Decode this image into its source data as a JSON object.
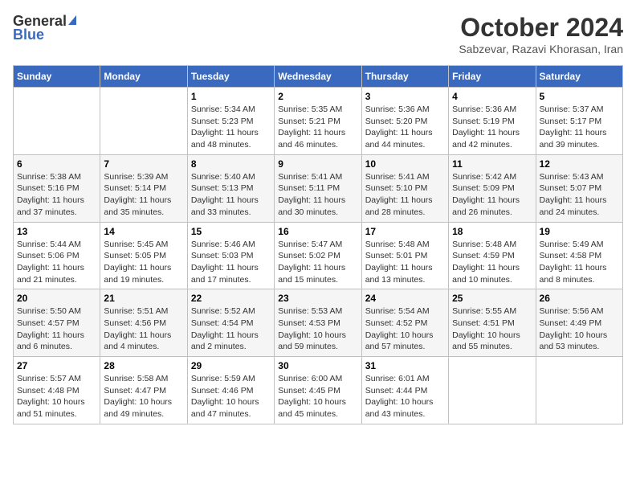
{
  "header": {
    "logo_general": "General",
    "logo_blue": "Blue",
    "month_title": "October 2024",
    "location": "Sabzevar, Razavi Khorasan, Iran"
  },
  "days_of_week": [
    "Sunday",
    "Monday",
    "Tuesday",
    "Wednesday",
    "Thursday",
    "Friday",
    "Saturday"
  ],
  "weeks": [
    {
      "days": [
        {
          "number": "",
          "sunrise": "",
          "sunset": "",
          "daylight": ""
        },
        {
          "number": "",
          "sunrise": "",
          "sunset": "",
          "daylight": ""
        },
        {
          "number": "1",
          "sunrise": "Sunrise: 5:34 AM",
          "sunset": "Sunset: 5:23 PM",
          "daylight": "Daylight: 11 hours and 48 minutes."
        },
        {
          "number": "2",
          "sunrise": "Sunrise: 5:35 AM",
          "sunset": "Sunset: 5:21 PM",
          "daylight": "Daylight: 11 hours and 46 minutes."
        },
        {
          "number": "3",
          "sunrise": "Sunrise: 5:36 AM",
          "sunset": "Sunset: 5:20 PM",
          "daylight": "Daylight: 11 hours and 44 minutes."
        },
        {
          "number": "4",
          "sunrise": "Sunrise: 5:36 AM",
          "sunset": "Sunset: 5:19 PM",
          "daylight": "Daylight: 11 hours and 42 minutes."
        },
        {
          "number": "5",
          "sunrise": "Sunrise: 5:37 AM",
          "sunset": "Sunset: 5:17 PM",
          "daylight": "Daylight: 11 hours and 39 minutes."
        }
      ]
    },
    {
      "days": [
        {
          "number": "6",
          "sunrise": "Sunrise: 5:38 AM",
          "sunset": "Sunset: 5:16 PM",
          "daylight": "Daylight: 11 hours and 37 minutes."
        },
        {
          "number": "7",
          "sunrise": "Sunrise: 5:39 AM",
          "sunset": "Sunset: 5:14 PM",
          "daylight": "Daylight: 11 hours and 35 minutes."
        },
        {
          "number": "8",
          "sunrise": "Sunrise: 5:40 AM",
          "sunset": "Sunset: 5:13 PM",
          "daylight": "Daylight: 11 hours and 33 minutes."
        },
        {
          "number": "9",
          "sunrise": "Sunrise: 5:41 AM",
          "sunset": "Sunset: 5:11 PM",
          "daylight": "Daylight: 11 hours and 30 minutes."
        },
        {
          "number": "10",
          "sunrise": "Sunrise: 5:41 AM",
          "sunset": "Sunset: 5:10 PM",
          "daylight": "Daylight: 11 hours and 28 minutes."
        },
        {
          "number": "11",
          "sunrise": "Sunrise: 5:42 AM",
          "sunset": "Sunset: 5:09 PM",
          "daylight": "Daylight: 11 hours and 26 minutes."
        },
        {
          "number": "12",
          "sunrise": "Sunrise: 5:43 AM",
          "sunset": "Sunset: 5:07 PM",
          "daylight": "Daylight: 11 hours and 24 minutes."
        }
      ]
    },
    {
      "days": [
        {
          "number": "13",
          "sunrise": "Sunrise: 5:44 AM",
          "sunset": "Sunset: 5:06 PM",
          "daylight": "Daylight: 11 hours and 21 minutes."
        },
        {
          "number": "14",
          "sunrise": "Sunrise: 5:45 AM",
          "sunset": "Sunset: 5:05 PM",
          "daylight": "Daylight: 11 hours and 19 minutes."
        },
        {
          "number": "15",
          "sunrise": "Sunrise: 5:46 AM",
          "sunset": "Sunset: 5:03 PM",
          "daylight": "Daylight: 11 hours and 17 minutes."
        },
        {
          "number": "16",
          "sunrise": "Sunrise: 5:47 AM",
          "sunset": "Sunset: 5:02 PM",
          "daylight": "Daylight: 11 hours and 15 minutes."
        },
        {
          "number": "17",
          "sunrise": "Sunrise: 5:48 AM",
          "sunset": "Sunset: 5:01 PM",
          "daylight": "Daylight: 11 hours and 13 minutes."
        },
        {
          "number": "18",
          "sunrise": "Sunrise: 5:48 AM",
          "sunset": "Sunset: 4:59 PM",
          "daylight": "Daylight: 11 hours and 10 minutes."
        },
        {
          "number": "19",
          "sunrise": "Sunrise: 5:49 AM",
          "sunset": "Sunset: 4:58 PM",
          "daylight": "Daylight: 11 hours and 8 minutes."
        }
      ]
    },
    {
      "days": [
        {
          "number": "20",
          "sunrise": "Sunrise: 5:50 AM",
          "sunset": "Sunset: 4:57 PM",
          "daylight": "Daylight: 11 hours and 6 minutes."
        },
        {
          "number": "21",
          "sunrise": "Sunrise: 5:51 AM",
          "sunset": "Sunset: 4:56 PM",
          "daylight": "Daylight: 11 hours and 4 minutes."
        },
        {
          "number": "22",
          "sunrise": "Sunrise: 5:52 AM",
          "sunset": "Sunset: 4:54 PM",
          "daylight": "Daylight: 11 hours and 2 minutes."
        },
        {
          "number": "23",
          "sunrise": "Sunrise: 5:53 AM",
          "sunset": "Sunset: 4:53 PM",
          "daylight": "Daylight: 10 hours and 59 minutes."
        },
        {
          "number": "24",
          "sunrise": "Sunrise: 5:54 AM",
          "sunset": "Sunset: 4:52 PM",
          "daylight": "Daylight: 10 hours and 57 minutes."
        },
        {
          "number": "25",
          "sunrise": "Sunrise: 5:55 AM",
          "sunset": "Sunset: 4:51 PM",
          "daylight": "Daylight: 10 hours and 55 minutes."
        },
        {
          "number": "26",
          "sunrise": "Sunrise: 5:56 AM",
          "sunset": "Sunset: 4:49 PM",
          "daylight": "Daylight: 10 hours and 53 minutes."
        }
      ]
    },
    {
      "days": [
        {
          "number": "27",
          "sunrise": "Sunrise: 5:57 AM",
          "sunset": "Sunset: 4:48 PM",
          "daylight": "Daylight: 10 hours and 51 minutes."
        },
        {
          "number": "28",
          "sunrise": "Sunrise: 5:58 AM",
          "sunset": "Sunset: 4:47 PM",
          "daylight": "Daylight: 10 hours and 49 minutes."
        },
        {
          "number": "29",
          "sunrise": "Sunrise: 5:59 AM",
          "sunset": "Sunset: 4:46 PM",
          "daylight": "Daylight: 10 hours and 47 minutes."
        },
        {
          "number": "30",
          "sunrise": "Sunrise: 6:00 AM",
          "sunset": "Sunset: 4:45 PM",
          "daylight": "Daylight: 10 hours and 45 minutes."
        },
        {
          "number": "31",
          "sunrise": "Sunrise: 6:01 AM",
          "sunset": "Sunset: 4:44 PM",
          "daylight": "Daylight: 10 hours and 43 minutes."
        },
        {
          "number": "",
          "sunrise": "",
          "sunset": "",
          "daylight": ""
        },
        {
          "number": "",
          "sunrise": "",
          "sunset": "",
          "daylight": ""
        }
      ]
    }
  ]
}
